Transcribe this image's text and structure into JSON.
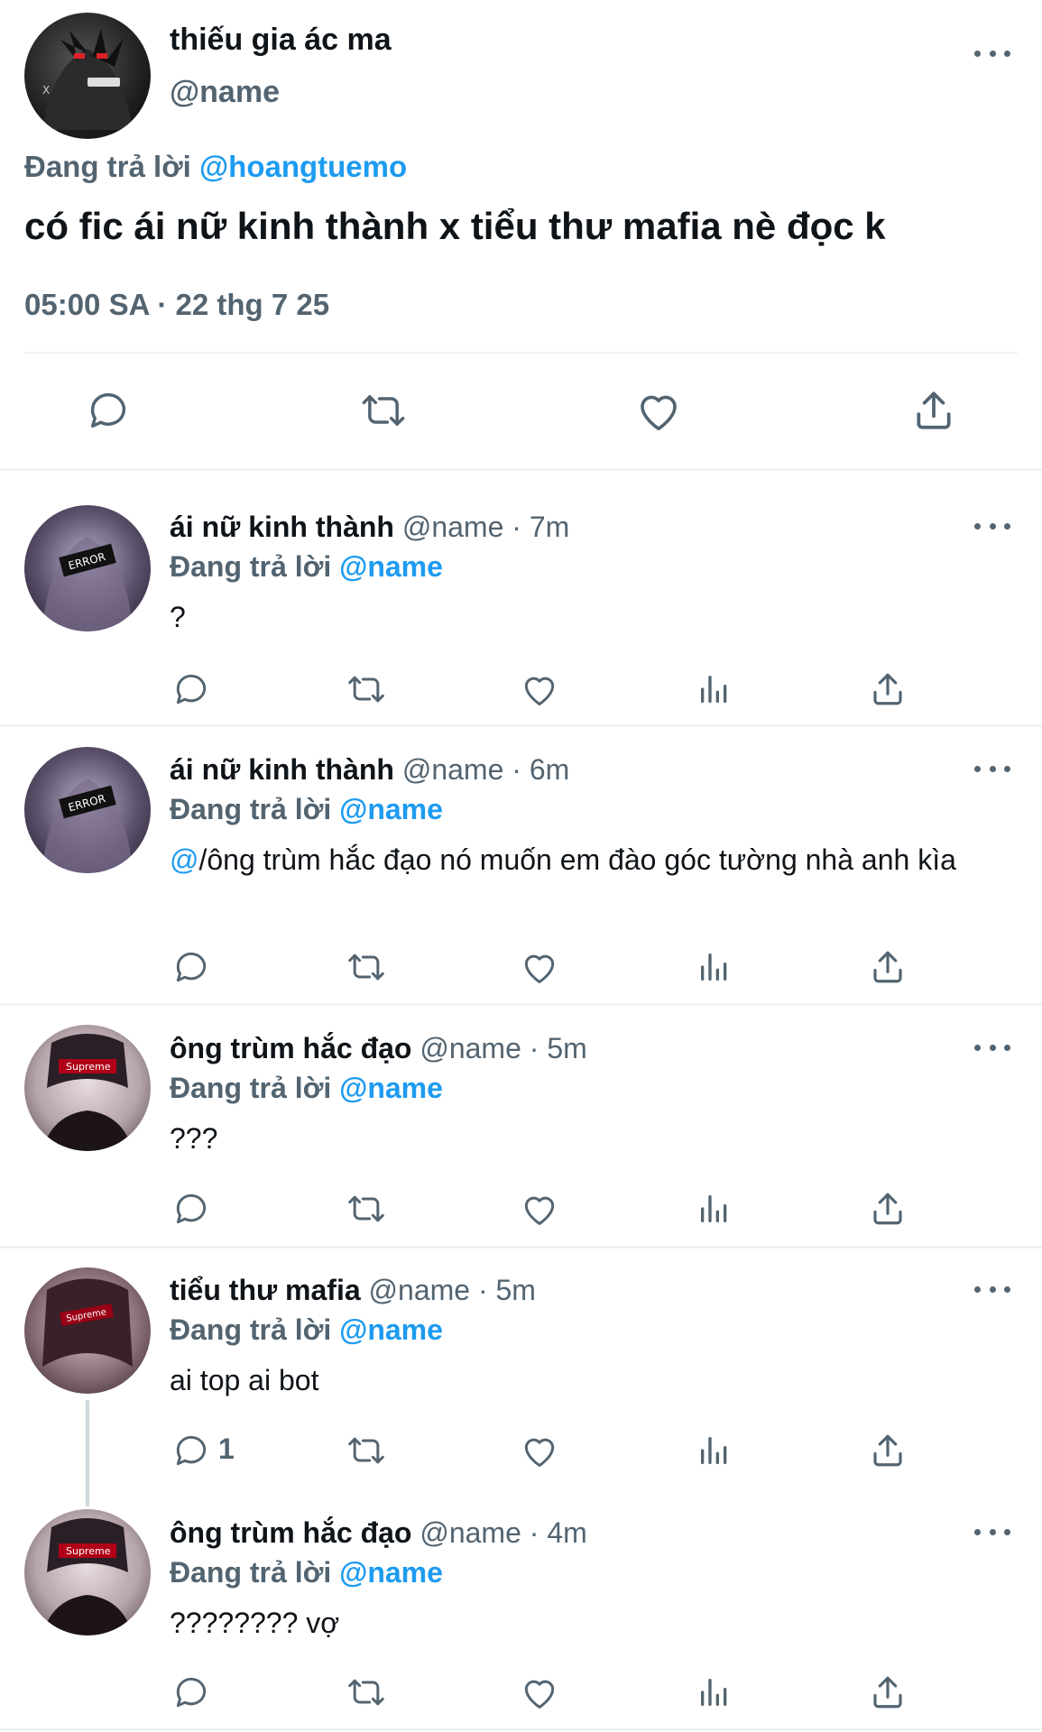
{
  "main_tweet": {
    "display_name": "thiếu gia ác ma",
    "handle": "@name",
    "replying_label": "Đang trả lời",
    "replying_to": "@hoangtuemo",
    "text": "có fic ái nữ kinh thành x tiểu thư mafia nè đọc k",
    "timestamp": "05:00 SA · 22 thg 7 25",
    "actions": [
      "reply-icon",
      "retweet-icon",
      "like-icon",
      "share-icon"
    ]
  },
  "replies": [
    {
      "display_name": "ái nữ kinh thành",
      "handle": "@name",
      "time": "· 7m",
      "replying_label": "Đang trả lời",
      "replying_to": "@name",
      "text": "?",
      "reply_count": ""
    },
    {
      "display_name": "ái nữ kinh thành",
      "handle": "@name",
      "time": "· 6m",
      "replying_label": "Đang trả lời",
      "replying_to": "@name",
      "mention": "@",
      "text": "/ông trùm hắc đạo nó muốn em đào góc tường nhà anh kìa",
      "reply_count": ""
    },
    {
      "display_name": "ông trùm hắc đạo",
      "handle": "@name",
      "time": "· 5m",
      "replying_label": "Đang trả lời",
      "replying_to": "@name",
      "text": "???",
      "reply_count": ""
    },
    {
      "display_name": "tiểu thư mafia",
      "handle": "@name",
      "time": "· 5m",
      "replying_label": "Đang trả lời",
      "replying_to": "@name",
      "text": "ai top ai bot",
      "reply_count": "1"
    },
    {
      "display_name": "ông trùm hắc đạo",
      "handle": "@name",
      "time": "· 4m",
      "replying_label": "Đang trả lời",
      "replying_to": "@name",
      "text": "???????? vợ",
      "reply_count": ""
    }
  ],
  "colors": {
    "text": "#0f1419",
    "muted": "#536471",
    "accent": "#1d9bf0",
    "divider": "#eff3f4"
  }
}
